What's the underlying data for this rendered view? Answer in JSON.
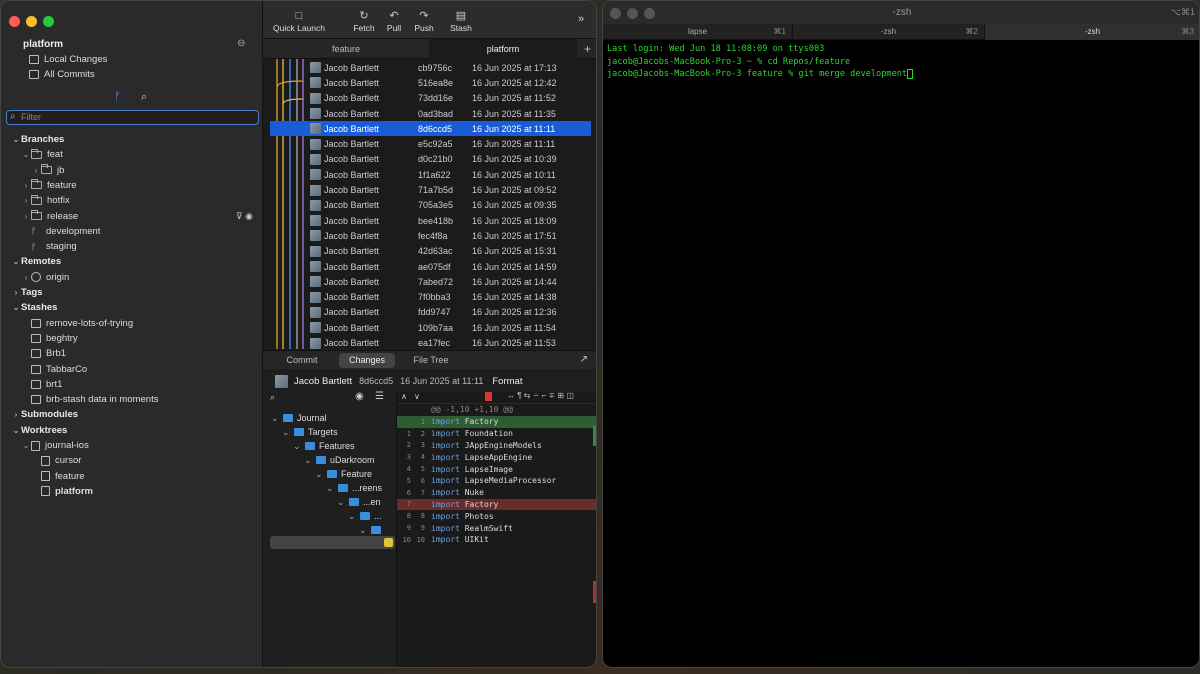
{
  "fork": {
    "repo_title": "platform",
    "top_items": [
      "Local Changes",
      "All Commits"
    ],
    "filter_placeholder": "Filter",
    "sidebar": [
      {
        "label": "Branches",
        "kind": "section",
        "indent": 0,
        "chev": "v"
      },
      {
        "label": "feat",
        "kind": "folder",
        "indent": 1,
        "chev": "v"
      },
      {
        "label": "jb",
        "kind": "folder",
        "indent": 2,
        "chev": ">"
      },
      {
        "label": "feature",
        "kind": "folder",
        "indent": 1,
        "chev": ">"
      },
      {
        "label": "hotfix",
        "kind": "folder",
        "indent": 1,
        "chev": ">"
      },
      {
        "label": "release",
        "kind": "folder",
        "indent": 1,
        "chev": ">"
      },
      {
        "label": "development",
        "kind": "branch",
        "indent": 1,
        "chev": ""
      },
      {
        "label": "staging",
        "kind": "branch",
        "indent": 1,
        "chev": ""
      },
      {
        "label": "Remotes",
        "kind": "section",
        "indent": 0,
        "chev": "v"
      },
      {
        "label": "origin",
        "kind": "remote",
        "indent": 1,
        "chev": ">"
      },
      {
        "label": "Tags",
        "kind": "section",
        "indent": 0,
        "chev": ">"
      },
      {
        "label": "Stashes",
        "kind": "section",
        "indent": 0,
        "chev": "v"
      },
      {
        "label": "remove-lots-of-trying",
        "kind": "stash",
        "indent": 1,
        "chev": ""
      },
      {
        "label": "beghtry",
        "kind": "stash",
        "indent": 1,
        "chev": ""
      },
      {
        "label": "Brb1",
        "kind": "stash",
        "indent": 1,
        "chev": ""
      },
      {
        "label": "TabbarCo",
        "kind": "stash",
        "indent": 1,
        "chev": ""
      },
      {
        "label": "brt1",
        "kind": "stash",
        "indent": 1,
        "chev": ""
      },
      {
        "label": "brb-stash data in moments",
        "kind": "stash",
        "indent": 1,
        "chev": ""
      },
      {
        "label": "Submodules",
        "kind": "section",
        "indent": 0,
        "chev": ">"
      },
      {
        "label": "Worktrees",
        "kind": "section",
        "indent": 0,
        "chev": "v"
      },
      {
        "label": "journal-ios",
        "kind": "repo",
        "indent": 1,
        "chev": "v"
      },
      {
        "label": "cursor",
        "kind": "repo",
        "indent": 2,
        "chev": ""
      },
      {
        "label": "feature",
        "kind": "repo",
        "indent": 2,
        "chev": ""
      },
      {
        "label": "platform",
        "kind": "repo-bold",
        "indent": 2,
        "chev": ""
      }
    ],
    "toolbar": [
      {
        "label": "Quick Launch",
        "icon": "quick-launch-icon",
        "glyph": "□"
      },
      {
        "label": "Fetch",
        "icon": "fetch-icon",
        "glyph": "↻"
      },
      {
        "label": "Pull",
        "icon": "pull-icon",
        "glyph": "↶"
      },
      {
        "label": "Push",
        "icon": "push-icon",
        "glyph": "↷"
      },
      {
        "label": "Stash",
        "icon": "stash-icon",
        "glyph": "▤"
      }
    ],
    "tabs": [
      "feature",
      "platform"
    ],
    "active_tab": 1,
    "commits": [
      {
        "author": "Jacob Bartlett",
        "hash": "cb9756c",
        "date": "16 Jun 2025 at 17:13"
      },
      {
        "author": "Jacob Bartlett",
        "hash": "516ea8e",
        "date": "16 Jun 2025 at 12:42"
      },
      {
        "author": "Jacob Bartlett",
        "hash": "73dd16e",
        "date": "16 Jun 2025 at 11:52"
      },
      {
        "author": "Jacob Bartlett",
        "hash": "0ad3bad",
        "date": "16 Jun 2025 at 11:35"
      },
      {
        "author": "Jacob Bartlett",
        "hash": "8d6ccd5",
        "date": "16 Jun 2025 at 11:11",
        "selected": true
      },
      {
        "author": "Jacob Bartlett",
        "hash": "e5c92a5",
        "date": "16 Jun 2025 at 11:11"
      },
      {
        "author": "Jacob Bartlett",
        "hash": "d0c21b0",
        "date": "16 Jun 2025 at 10:39"
      },
      {
        "author": "Jacob Bartlett",
        "hash": "1f1a622",
        "date": "16 Jun 2025 at 10:11"
      },
      {
        "author": "Jacob Bartlett",
        "hash": "71a7b5d",
        "date": "16 Jun 2025 at 09:52"
      },
      {
        "author": "Jacob Bartlett",
        "hash": "705a3e5",
        "date": "16 Jun 2025 at 09:35"
      },
      {
        "author": "Jacob Bartlett",
        "hash": "bee418b",
        "date": "16 Jun 2025 at 18:09"
      },
      {
        "author": "Jacob Bartlett",
        "hash": "fec4f8a",
        "date": "16 Jun 2025 at 17:51"
      },
      {
        "author": "Jacob Bartlett",
        "hash": "42d63ac",
        "date": "16 Jun 2025 at 15:31"
      },
      {
        "author": "Jacob Bartlett",
        "hash": "ae075df",
        "date": "16 Jun 2025 at 14:59"
      },
      {
        "author": "Jacob Bartlett",
        "hash": "7abed72",
        "date": "16 Jun 2025 at 14:44"
      },
      {
        "author": "Jacob Bartlett",
        "hash": "7f0bba3",
        "date": "16 Jun 2025 at 14:38"
      },
      {
        "author": "Jacob Bartlett",
        "hash": "fdd9747",
        "date": "16 Jun 2025 at 12:36"
      },
      {
        "author": "Jacob Bartlett",
        "hash": "109b7aa",
        "date": "16 Jun 2025 at 11:54"
      },
      {
        "author": "Jacob Bartlett",
        "hash": "ea17fec",
        "date": "16 Jun 2025 at 11:53"
      }
    ],
    "lower_tabs": [
      "Commit",
      "Changes",
      "File Tree"
    ],
    "active_lower_tab": 1,
    "commit_head": {
      "author": "Jacob Bartlett",
      "hash": "8d6ccd5",
      "date": "16 Jun 2025 at 11:11",
      "action": "Format"
    },
    "file_tree": [
      {
        "label": "Journal",
        "indent": 0
      },
      {
        "label": "Targets",
        "indent": 1
      },
      {
        "label": "Features",
        "indent": 2
      },
      {
        "label": "uDarkroom",
        "indent": 3
      },
      {
        "label": "Feature",
        "indent": 4
      },
      {
        "label": "...reens",
        "indent": 5
      },
      {
        "label": "...en",
        "indent": 6
      },
      {
        "label": "...",
        "indent": 7
      },
      {
        "label": "",
        "indent": 8
      }
    ],
    "diff": {
      "hunk": "@@ -1,10 +1,10 @@",
      "lines": [
        {
          "old": "",
          "new": "1",
          "kw": "import",
          "name": "Factory",
          "type": "add"
        },
        {
          "old": "1",
          "new": "2",
          "kw": "import",
          "name": "Foundation",
          "type": "ctx"
        },
        {
          "old": "2",
          "new": "3",
          "kw": "import",
          "name": "JAppEngineModels",
          "type": "ctx"
        },
        {
          "old": "3",
          "new": "4",
          "kw": "import",
          "name": "LapseAppEngine",
          "type": "ctx"
        },
        {
          "old": "4",
          "new": "5",
          "kw": "import",
          "name": "LapseImage",
          "type": "ctx"
        },
        {
          "old": "5",
          "new": "6",
          "kw": "import",
          "name": "LapseMediaProcessor",
          "type": "ctx"
        },
        {
          "old": "6",
          "new": "7",
          "kw": "import",
          "name": "Nuke",
          "type": "ctx"
        },
        {
          "old": "7",
          "new": "",
          "kw": "import",
          "name": "Factory",
          "type": "del"
        },
        {
          "old": "8",
          "new": "8",
          "kw": "import",
          "name": "Photos",
          "type": "ctx"
        },
        {
          "old": "9",
          "new": "9",
          "kw": "import",
          "name": "RealmSwift",
          "type": "ctx"
        },
        {
          "old": "10",
          "new": "10",
          "kw": "import",
          "name": "UIKit",
          "type": "ctx"
        }
      ]
    }
  },
  "terminal": {
    "title": "-zsh",
    "title_shortcut": "⌥⌘1",
    "tabs": [
      {
        "label": "lapse",
        "kbd": "⌘1"
      },
      {
        "label": "-zsh",
        "kbd": "⌘2"
      },
      {
        "label": "-zsh",
        "kbd": "⌘3"
      }
    ],
    "active_tab": 2,
    "lines": [
      "Last login: Wed Jun 18 11:08:09 on ttys003",
      "jacob@Jacobs-MacBook-Pro-3 ~ % cd Repos/feature",
      "jacob@Jacobs-MacBook-Pro-3 feature % git merge development"
    ]
  },
  "colors": {
    "accent": "#1a5cd6",
    "add_bg": "#2e5d33",
    "del_bg": "#6a2b2b",
    "terminal_text": "#2ed62e"
  }
}
